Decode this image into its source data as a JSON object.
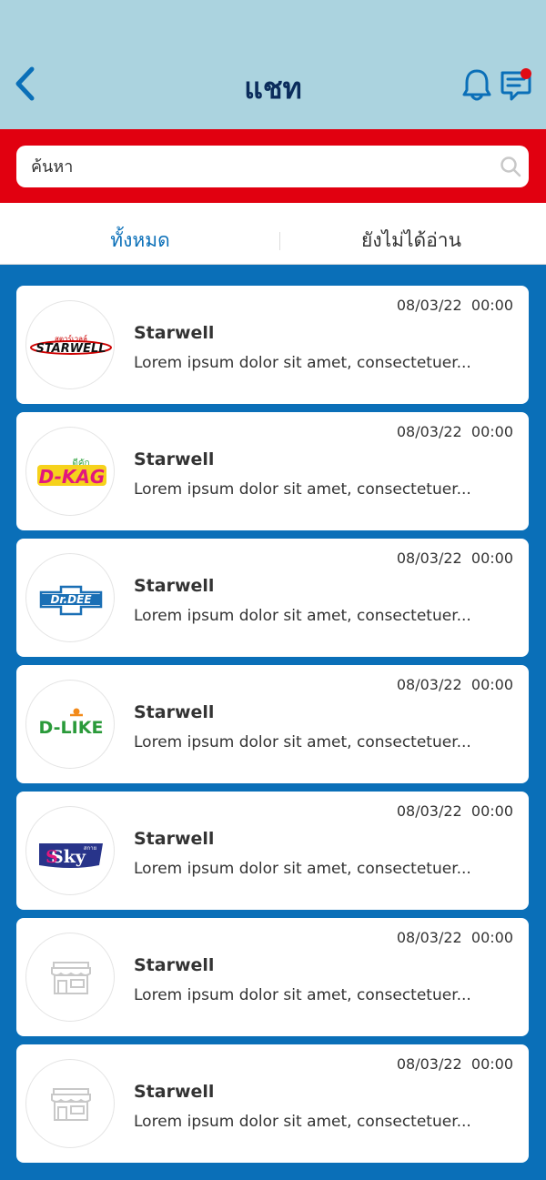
{
  "header": {
    "title": "แชท",
    "back_icon": "chevron-left-icon",
    "bell_icon": "bell-icon",
    "message_icon": "message-icon",
    "accent_color": "#0a6fb8",
    "badge_color": "#e00b14"
  },
  "search": {
    "placeholder": "ค้นหา",
    "icon": "search-icon"
  },
  "tabs": [
    {
      "label": "ทั้งหมด",
      "active": true
    },
    {
      "label": "ยังไม่ได้อ่าน",
      "active": false
    }
  ],
  "chats": [
    {
      "logo": "starwell-logo",
      "logo_text": "สตาร์เวลล์ STARWELL",
      "time": "08/03/22  00:00",
      "name": "Starwell",
      "preview": "Lorem ipsum dolor sit amet, consectetuer..."
    },
    {
      "logo": "dkag-logo",
      "logo_text": "ดีคัก D-KAG",
      "time": "08/03/22  00:00",
      "name": "Starwell",
      "preview": "Lorem ipsum dolor sit amet, consectetuer..."
    },
    {
      "logo": "drdee-logo",
      "logo_text": "Dr.DEE",
      "time": "08/03/22  00:00",
      "name": "Starwell",
      "preview": "Lorem ipsum dolor sit amet, consectetuer..."
    },
    {
      "logo": "dlike-logo",
      "logo_text": "D-LIKE",
      "time": "08/03/22  00:00",
      "name": "Starwell",
      "preview": "Lorem ipsum dolor sit amet, consectetuer..."
    },
    {
      "logo": "sky-logo",
      "logo_text": "สกาย Sky",
      "time": "08/03/22  00:00",
      "name": "Starwell",
      "preview": "Lorem ipsum dolor sit amet, consectetuer..."
    },
    {
      "logo": "store-icon",
      "time": "08/03/22  00:00",
      "name": "Starwell",
      "preview": "Lorem ipsum dolor sit amet, consectetuer..."
    },
    {
      "logo": "store-icon",
      "time": "08/03/22  00:00",
      "name": "Starwell",
      "preview": "Lorem ipsum dolor sit amet, consectetuer..."
    }
  ]
}
